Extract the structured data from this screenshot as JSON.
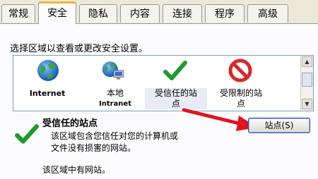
{
  "tabs": [
    {
      "label": "常规"
    },
    {
      "label": "安全"
    },
    {
      "label": "隐私"
    },
    {
      "label": "内容"
    },
    {
      "label": "连接"
    },
    {
      "label": "程序"
    },
    {
      "label": "高级"
    }
  ],
  "active_tab": "安全",
  "instruction": "选择区域以查看或更改安全设置。",
  "zones": [
    {
      "label_line1": "Internet",
      "label_line2": "",
      "icon": "globe-icon"
    },
    {
      "label_line1": "本地",
      "label_line2": "Intranet",
      "icon": "globe-computer-icon"
    },
    {
      "label_line1": "受信任的站",
      "label_line2": "点",
      "icon": "checkmark-icon"
    },
    {
      "label_line1": "受限制的站",
      "label_line2": "点",
      "icon": "restricted-icon"
    }
  ],
  "selected_zone": {
    "title": "受信任的站点",
    "description_line1": "该区域包含您信任对您的计算机或",
    "description_line2": "文件没有损害的网站。",
    "status": "该区域中有网站。"
  },
  "sites_button_label": "站点(S)",
  "colors": {
    "accent_tab": "#f5b43c",
    "check_green": "#1f9a2c",
    "restricted_red": "#d42a2a",
    "arrow_red": "#e0141e"
  }
}
